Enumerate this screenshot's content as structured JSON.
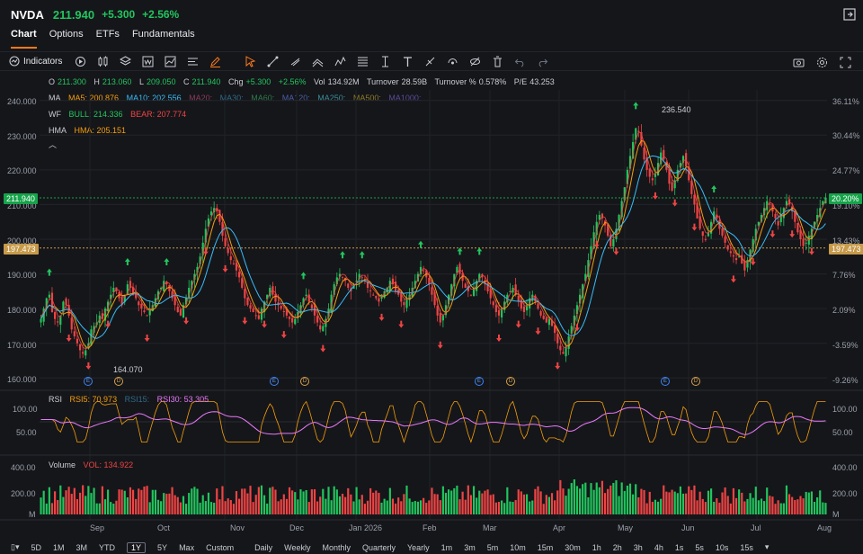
{
  "header": {
    "ticker": "NVDA",
    "price": "211.940",
    "change": "+5.300",
    "change_pct": "+2.56%"
  },
  "tabs": [
    {
      "label": "Chart",
      "active": true
    },
    {
      "label": "Options"
    },
    {
      "label": "ETFs"
    },
    {
      "label": "Fundamentals"
    }
  ],
  "toolbar": {
    "indicators_label": "Indicators"
  },
  "quote": {
    "o_label": "O",
    "o": "211.300",
    "h_label": "H",
    "h": "213.060",
    "l_label": "L",
    "l": "209.050",
    "c_label": "C",
    "c": "211.940",
    "chg_label": "Chg",
    "chg": "+5.300",
    "chg_pct": "+2.56%",
    "vol_label": "Vol",
    "vol": "134.92M",
    "turnover_label": "Turnover",
    "turnover": "28.59B",
    "turnover_pct_label": "Turnover %",
    "turnover_pct": "0.578%",
    "pe_label": "P/E",
    "pe": "43.253"
  },
  "ma": {
    "label": "MA",
    "ma5": "MA5: 200.876",
    "ma10": "MA10: 202.556",
    "ma20": "MA20:",
    "ma30": "MA30:",
    "ma60": "MA60:",
    "ma120": "MA120:",
    "ma250": "MA250:",
    "ma500": "MA500:",
    "ma1000": "MA1000:"
  },
  "wf": {
    "label": "WF",
    "bull": "BULL: 214.336",
    "bear": "BEAR: 207.774"
  },
  "hma": {
    "label": "HMA",
    "value": "HMA: 205.151"
  },
  "price_axis": [
    "240.000",
    "230.000",
    "220.000",
    "210.000",
    "200.000",
    "190.000",
    "180.000",
    "170.000",
    "160.000"
  ],
  "pct_axis": [
    "36.11%",
    "30.44%",
    "24.77%",
    "19.10%",
    "13.43%",
    "7.76%",
    "2.09%",
    "-3.59%",
    "-9.26%"
  ],
  "current_price_tag": "211.940",
  "current_pct_tag": "20.20%",
  "ref_price_tag": "197.473",
  "ref_pct_tag": "197.473",
  "high_label": "236.540",
  "low_label": "164.070",
  "rsi": {
    "label": "RSI",
    "rsi5": "RSI5: 70.973",
    "rsi15": "RSI15:",
    "rsi30": "RSI30: 53.305",
    "axis": [
      "100.00",
      "50.00",
      "0.00"
    ],
    "right_axis": [
      "100.00",
      "50.00"
    ]
  },
  "volume": {
    "label": "Volume",
    "vol": "VOL: 134.922",
    "axis": [
      "400.00",
      "200.00",
      "M"
    ]
  },
  "months": [
    "Sep",
    "Oct",
    "Nov",
    "Dec",
    "Jan 2026",
    "Feb",
    "Mar",
    "Apr",
    "May",
    "Jun",
    "Jul",
    "Aug"
  ],
  "events": [
    {
      "type": "E"
    },
    {
      "type": "D"
    },
    {
      "type": "E"
    },
    {
      "type": "D"
    },
    {
      "type": "E"
    },
    {
      "type": "D"
    },
    {
      "type": "E"
    },
    {
      "type": "D"
    }
  ],
  "timeframes": [
    "5D",
    "1M",
    "3M",
    "YTD",
    "1Y",
    "5Y",
    "Max",
    "Custom",
    "Daily",
    "Weekly",
    "Monthly",
    "Quarterly",
    "Yearly",
    "1m",
    "3m",
    "5m",
    "10m",
    "15m",
    "30m",
    "1h",
    "2h",
    "3h",
    "4h",
    "1s",
    "5s",
    "10s",
    "15s"
  ],
  "active_timeframe": "1Y",
  "colors": {
    "up": "#22c55e",
    "down": "#ef4444",
    "ma5": "#f59e0b",
    "ma10": "#38bdf8",
    "accent": "#ff7a1a",
    "rsi5": "#f59e0b",
    "rsi30": "#e879f9"
  },
  "chart_data": {
    "type": "candlestick",
    "ylim": [
      158,
      242
    ],
    "closes": [
      177,
      180,
      183,
      184,
      179,
      177,
      176,
      178,
      182,
      181,
      178,
      174,
      172,
      170,
      168,
      167,
      168,
      170,
      174,
      175,
      176,
      178,
      177,
      180,
      182,
      184,
      186,
      185,
      183,
      181,
      184,
      187,
      186,
      184,
      183,
      181,
      180,
      179,
      178,
      180,
      181,
      183,
      185,
      186,
      188,
      187,
      185,
      183,
      181,
      179,
      178,
      181,
      183,
      186,
      188,
      190,
      192,
      195,
      199,
      203,
      206,
      208,
      209,
      208,
      205,
      201,
      198,
      196,
      194,
      193,
      191,
      189,
      186,
      183,
      181,
      180,
      179,
      178,
      177,
      180,
      182,
      184,
      186,
      184,
      182,
      181,
      180,
      179,
      178,
      177,
      176,
      177,
      179,
      181,
      183,
      184,
      182,
      180,
      178,
      176,
      174,
      175,
      177,
      180,
      184,
      187,
      189,
      190,
      189,
      188,
      186,
      185,
      187,
      188,
      190,
      189,
      188,
      186,
      185,
      184,
      183,
      182,
      184,
      185,
      186,
      188,
      187,
      185,
      184,
      182,
      181,
      183,
      184,
      186,
      188,
      190,
      192,
      191,
      189,
      187,
      184,
      181,
      178,
      176,
      178,
      181,
      184,
      187,
      190,
      192,
      190,
      188,
      186,
      185,
      184,
      186,
      188,
      190,
      189,
      187,
      185,
      183,
      181,
      179,
      178,
      180,
      182,
      184,
      185,
      186,
      184,
      182,
      180,
      179,
      181,
      183,
      184,
      182,
      180,
      178,
      177,
      176,
      177,
      175,
      173,
      170,
      168,
      167,
      169,
      172,
      175,
      178,
      181,
      184,
      187,
      190,
      194,
      198,
      202,
      205,
      207,
      206,
      204,
      201,
      198,
      200,
      203,
      207,
      211,
      215,
      220,
      224,
      228,
      232,
      231,
      227,
      223,
      220,
      218,
      217,
      219,
      222,
      225,
      223,
      220,
      216,
      214,
      217,
      220,
      222,
      224,
      221,
      217,
      213,
      210,
      206,
      203,
      201,
      200,
      202,
      205,
      208,
      206,
      203,
      201,
      199,
      197,
      196,
      195,
      194,
      195,
      193,
      191,
      194,
      197,
      200,
      203,
      205,
      207,
      209,
      211,
      210,
      208,
      206,
      204,
      207,
      209,
      211,
      210,
      208,
      205,
      202,
      200,
      198,
      199,
      201,
      203,
      205,
      207,
      209,
      211,
      212
    ],
    "rsi_ylim": [
      0,
      100
    ],
    "vol_ylim": [
      0,
      500
    ]
  }
}
